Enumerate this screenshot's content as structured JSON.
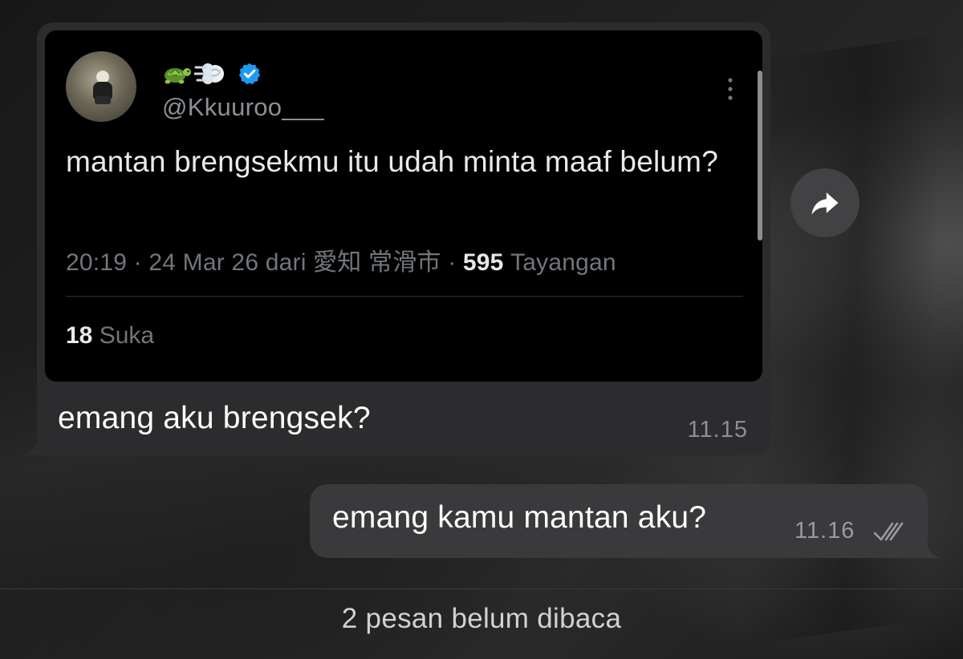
{
  "tweet": {
    "name_emojis": [
      "turtle",
      "dash"
    ],
    "verified": true,
    "handle": "@Kkuuroo___",
    "text": "mantan brengsekmu itu udah minta maaf belum?",
    "meta_prefix": "20:19 · 24 Mar 26 dari 愛知 常滑市 · ",
    "views_count": "595",
    "views_label": " Tayangan",
    "likes_count": "18",
    "likes_label": " Suka"
  },
  "incoming_message": {
    "text": "emang aku brengsek?",
    "time": "11.15"
  },
  "outgoing_message": {
    "text": "emang kamu mantan aku?",
    "time": "11.16",
    "status": "read"
  },
  "unread_notice": "2 pesan belum dibaca",
  "icons": {
    "verified": "verified-badge-icon",
    "more": "more-vertical-icon",
    "share": "share-forward-icon",
    "read": "double-check-icon"
  },
  "colors": {
    "verified": "#1d9bf0",
    "incoming_bubble": "#2c2c2e",
    "outgoing_bubble": "#3a3a3c",
    "tweet_card": "#000000"
  }
}
